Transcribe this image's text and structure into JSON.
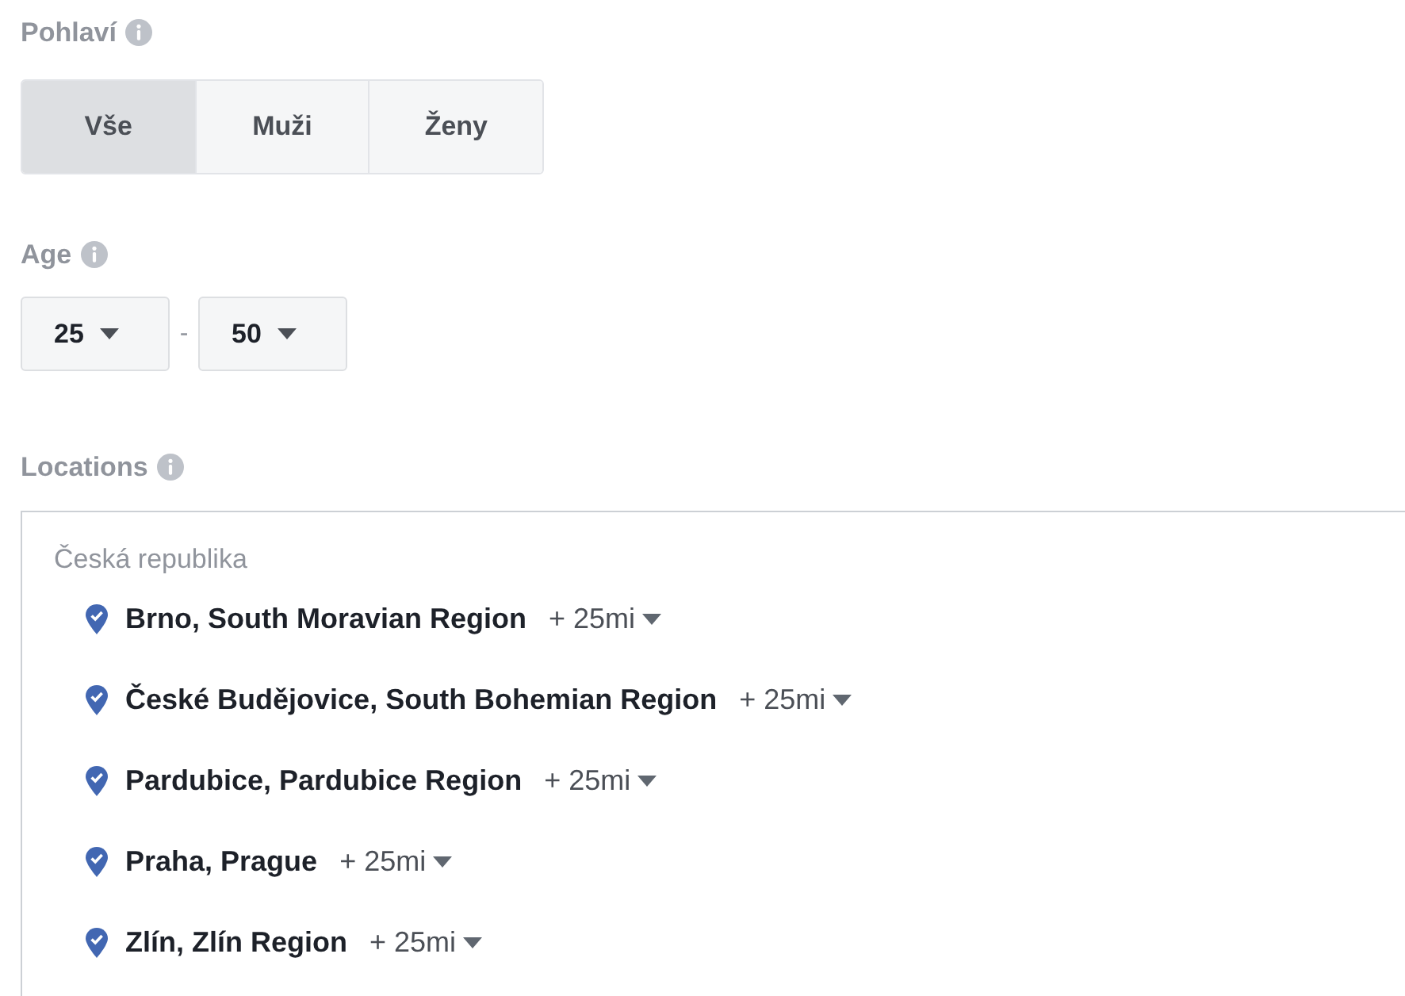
{
  "gender": {
    "label": "Pohlaví",
    "options": [
      {
        "label": "Vše",
        "selected": true
      },
      {
        "label": "Muži",
        "selected": false
      },
      {
        "label": "Ženy",
        "selected": false
      }
    ]
  },
  "age": {
    "label": "Age",
    "min": "25",
    "separator": "-",
    "max": "50"
  },
  "locations": {
    "label": "Locations",
    "country": "Česká republika",
    "items": [
      {
        "name": "Brno, South Moravian Region",
        "radius": "+ 25mi"
      },
      {
        "name": "České Budějovice, South Bohemian Region",
        "radius": "+ 25mi"
      },
      {
        "name": "Pardubice, Pardubice Region",
        "radius": "+ 25mi"
      },
      {
        "name": "Praha, Prague",
        "radius": "+ 25mi"
      },
      {
        "name": "Zlín, Zlín Region",
        "radius": "+ 25mi"
      }
    ]
  }
}
